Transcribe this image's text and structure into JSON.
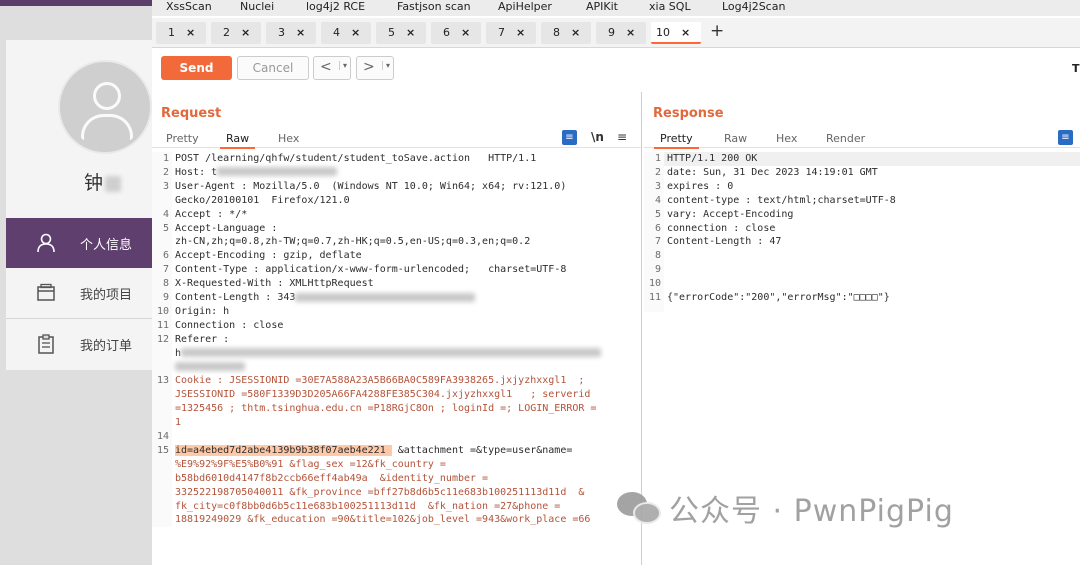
{
  "background": {
    "username": "钟",
    "menu": [
      "个人信息",
      "我的项目",
      "我的订单"
    ]
  },
  "extensions": [
    "XssScan",
    "Nuclei",
    "log4j2 RCE",
    "Fastjson scan",
    "ApiHelper",
    "APIKit",
    "xia SQL",
    "Log4j2Scan"
  ],
  "repeater_tabs": [
    "1",
    "2",
    "3",
    "4",
    "5",
    "6",
    "7",
    "8",
    "9",
    "10"
  ],
  "active_tab": "10",
  "tab_close": "×",
  "add_tab": "+",
  "toolbar": {
    "send": "Send",
    "cancel": "Cancel",
    "back": "<",
    "forward": ">",
    "dropdown": "▾",
    "target": "T"
  },
  "request": {
    "title": "Request",
    "tabs": [
      "Pretty",
      "Raw",
      "Hex"
    ],
    "active_tab": "Raw",
    "newline_toggle": "\\n",
    "menu_icon": "≡",
    "lines": [
      {
        "n": "1",
        "text": "POST /learning/qhfw/student/student_toSave.action   HTTP/1.1"
      },
      {
        "n": "2",
        "text": "Host: t"
      },
      {
        "n": "3",
        "text": "User-Agent : Mozilla/5.0  (Windows NT 10.0; Win64; x64; rv:121.0)"
      },
      {
        "n": "",
        "text": "Gecko/20100101  Firefox/121.0"
      },
      {
        "n": "4",
        "text": "Accept : */*"
      },
      {
        "n": "5",
        "text": "Accept-Language :"
      },
      {
        "n": "",
        "text": "zh-CN,zh;q=0.8,zh-TW;q=0.7,zh-HK;q=0.5,en-US;q=0.3,en;q=0.2"
      },
      {
        "n": "6",
        "text": "Accept-Encoding : gzip, deflate"
      },
      {
        "n": "7",
        "text": "Content-Type : application/x-www-form-urlencoded;   charset=UTF-8"
      },
      {
        "n": "8",
        "text": "X-Requested-With : XMLHttpRequest"
      },
      {
        "n": "9",
        "text": "Content-Length : 343"
      },
      {
        "n": "10",
        "text": "Origin: h"
      },
      {
        "n": "11",
        "text": "Connection : close"
      },
      {
        "n": "12",
        "text": "Referer :"
      },
      {
        "n": "",
        "text": "h"
      },
      {
        "n": "",
        "text": ""
      },
      {
        "n": "13",
        "text": "Cookie : JSESSIONID =30E7A588A23A5B66BA0C589FA3938265.jxjyzhxxgl1  ;"
      },
      {
        "n": "",
        "text": "JSESSIONID =580F1339D3D205A66FA4288FE385C304.jxjyzhxxgl1   ; serverid"
      },
      {
        "n": "",
        "text": "=1325456 ; thtm.tsinghua.edu.cn =P18RGjC8On ; loginId =; LOGIN_ERROR ="
      },
      {
        "n": "",
        "text": "1"
      },
      {
        "n": "14",
        "text": ""
      },
      {
        "n": "15",
        "text": "&attachment =&type=user&name="
      },
      {
        "n": "",
        "text": "%E9%92%9F%E5%B0%91 &flag_sex =12&fk_country ="
      },
      {
        "n": "",
        "text": "b58bd6010d4147f8b2ccb66eff4ab49a  &identity_number ="
      },
      {
        "n": "",
        "text": "332522198705040011 &fk_province =bff27b8d6b5c11e683b100251113d11d  &"
      },
      {
        "n": "",
        "text": "fk_city=c0f8bb0d6b5c11e683b100251113d11d  &fk_nation =27&phone ="
      },
      {
        "n": "",
        "text": "18819249029 &fk_education =90&title=102&job_level =943&work_place =66"
      }
    ],
    "highlight": "id=a4ebed7d2abe4139b9b38f07aeb4e221 "
  },
  "response": {
    "title": "Response",
    "tabs": [
      "Pretty",
      "Raw",
      "Hex",
      "Render"
    ],
    "active_tab": "Pretty",
    "lines": [
      {
        "n": "1",
        "text": "HTTP/1.1 200 OK"
      },
      {
        "n": "2",
        "text": "date: Sun, 31 Dec 2023 14:19:01 GMT"
      },
      {
        "n": "3",
        "text": "expires : 0"
      },
      {
        "n": "4",
        "text": "content-type : text/html;charset=UTF-8"
      },
      {
        "n": "5",
        "text": "vary: Accept-Encoding"
      },
      {
        "n": "6",
        "text": "connection : close"
      },
      {
        "n": "7",
        "text": "Content-Length : 47"
      },
      {
        "n": "8",
        "text": ""
      },
      {
        "n": "9",
        "text": ""
      },
      {
        "n": "10",
        "text": ""
      },
      {
        "n": "11",
        "text": "{\"errorCode\":\"200\",\"errorMsg\":\"□□□□\"}"
      }
    ]
  },
  "watermark": {
    "text": "公众号 · PwnPigPig"
  }
}
